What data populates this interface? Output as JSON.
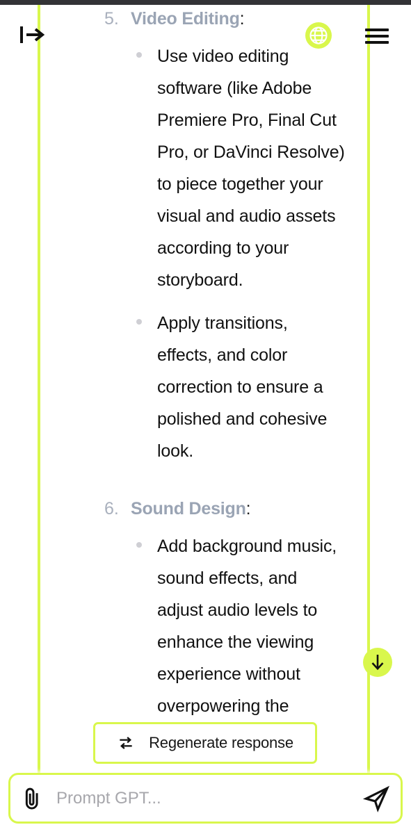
{
  "header": {
    "sidebar_toggle_icon": "open-sidebar-arrow-icon",
    "globe_icon": "globe-icon",
    "menu_icon": "hamburger-menu-icon"
  },
  "conversation": {
    "sections": [
      {
        "number": "5.",
        "title": "Video Editing",
        "colon": ":",
        "bullets": [
          "Use video editing software (like Adobe Premiere Pro, Final Cut Pro, or DaVinci Resolve) to piece together your visual and audio assets according to your storyboard.",
          "Apply transitions, effects, and color correction to ensure a polished and cohesive look."
        ]
      },
      {
        "number": "6.",
        "title": "Sound Design",
        "colon": ":",
        "bullets": [
          "Add background music, sound effects, and adjust audio levels to enhance the viewing experience without overpowering the narration."
        ]
      }
    ]
  },
  "scroll_button": {
    "icon": "arrow-down-icon"
  },
  "regenerate": {
    "label": "Regenerate response",
    "icon": "refresh-loop-icon"
  },
  "composer": {
    "attach_icon": "paperclip-icon",
    "placeholder": "Prompt GPT...",
    "value": "",
    "send_icon": "send-paper-plane-icon"
  },
  "colors": {
    "accent": "#d9f74c",
    "topbar": "#333336",
    "heading": "#9aa4b4",
    "body_text": "#111111",
    "bullet_dot": "#cfcfd4",
    "placeholder": "#a7a7ac"
  }
}
